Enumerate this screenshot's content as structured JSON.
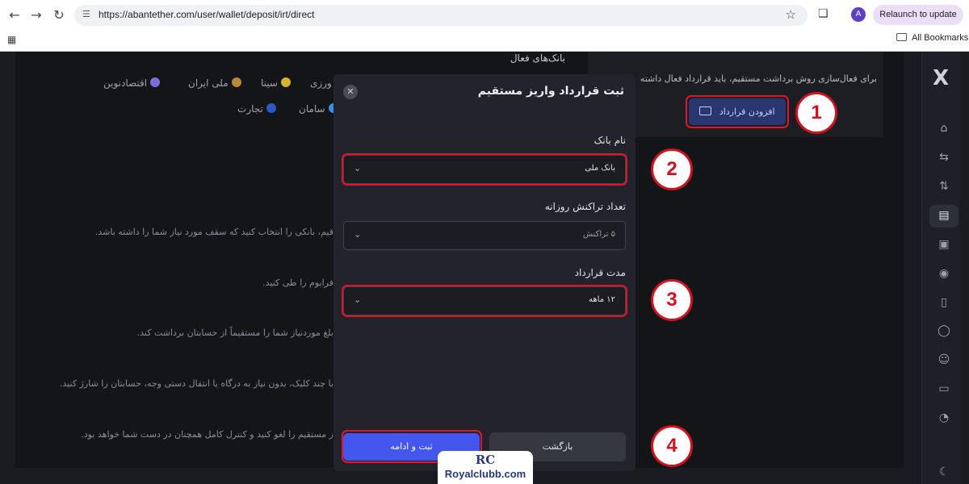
{
  "browser": {
    "url": "https://abantether.com/user/wallet/deposit/irt/direct",
    "avatar_letter": "A",
    "relaunch_label": "Relaunch to update",
    "bookmarks_label": "All Bookmarks"
  },
  "contract_card": {
    "text": "برای فعال‌سازی روش برداشت مستقیم، باید قرارداد فعال داشته",
    "add_button_label": "افزودن قرارداد"
  },
  "banks": {
    "title": "بانک‌های فعال",
    "row1": [
      "اقتصادنوین",
      "ملی ایران",
      "سینا",
      "ورزی"
    ],
    "row2": [
      "تجارت",
      "سامان"
    ]
  },
  "steps": [
    "قیم، بانکی را انتخاب کنید که سقف مورد نیاز شما را داشته باشد.",
    "فرابوم را طی کنید.",
    "بلغ موردنیاز شما را مستقیماً از حسابتان برداشت کند.",
    "با چند کلیک، بدون نیاز به درگاه یا انتقال دستی وجه، حسابتان را شارژ کنید.",
    "ز مستقیم را لغو کنید و کنترل کامل همچنان در دست شما خواهد بود."
  ],
  "modal": {
    "title": "ثبت قرارداد واریز مستقیم",
    "bank_label": "نام بانک",
    "bank_value": "بانک ملی",
    "tx_label": "تعداد تراکنش روزانه",
    "tx_value": "۵ تراکنش",
    "duration_label": "مدت قرارداد",
    "duration_value": "۱۲ ماهه",
    "submit_label": "ثبت و ادامه",
    "back_label": "بازگشت"
  },
  "markers": [
    "1",
    "2",
    "3",
    "4"
  ],
  "watermark": {
    "mark": "RC",
    "text": "Royalclubb.com"
  },
  "colors": {
    "accent": "#4556ee",
    "highlight": "#e0152b",
    "background": "#1b1c21"
  }
}
